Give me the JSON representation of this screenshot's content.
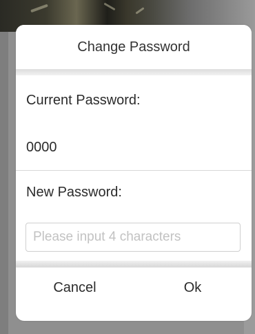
{
  "dialog": {
    "title": "Change Password",
    "current_password_label": "Current Password:",
    "current_password_value": "0000",
    "new_password_label": "New Password:",
    "new_password_placeholder": "Please input 4 characters",
    "cancel_label": "Cancel",
    "ok_label": "Ok"
  }
}
